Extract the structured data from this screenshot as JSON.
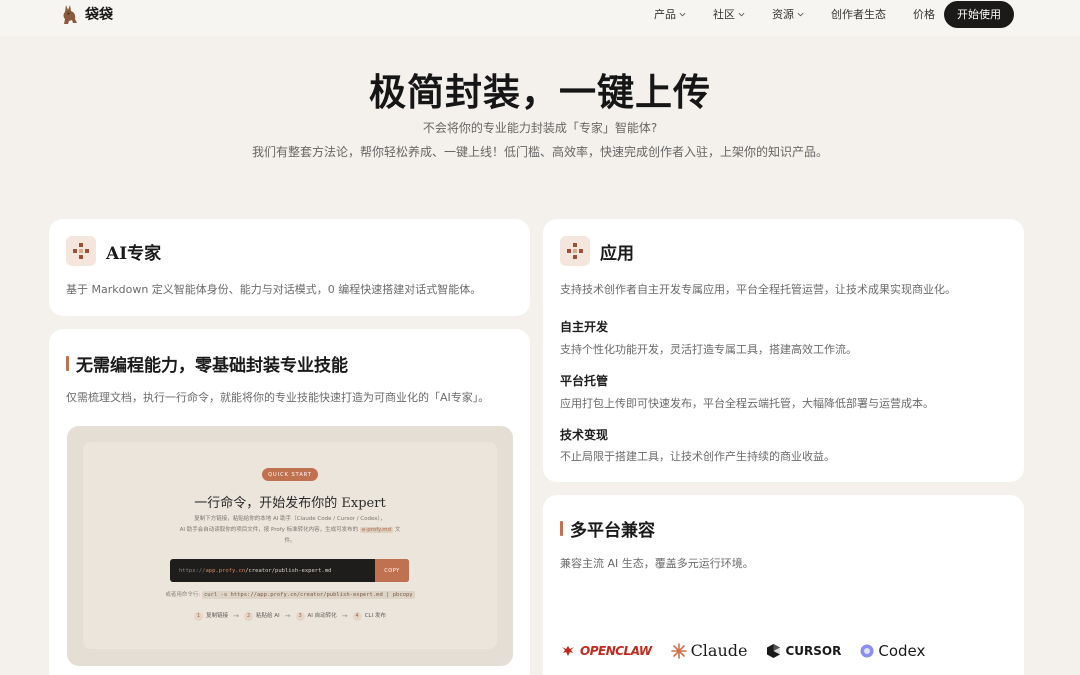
{
  "header": {
    "brand": "袋袋",
    "nav": [
      {
        "label": "产品",
        "dropdown": true
      },
      {
        "label": "社区",
        "dropdown": true
      },
      {
        "label": "资源",
        "dropdown": true
      },
      {
        "label": "创作者生态",
        "dropdown": false
      },
      {
        "label": "价格",
        "dropdown": false
      }
    ],
    "cta": "开始使用"
  },
  "hero": {
    "title": "极简封装，一键上传",
    "subtitle": "不会将你的专业能力封装成「专家」智能体?",
    "description": "我们有整套方法论，帮你轻松养成、一键上线！低门槛、高效率，快速完成创作者入驻，上架你的知识产品。"
  },
  "cards": {
    "ai_expert": {
      "title": "AI专家",
      "text": "基于 Markdown 定义智能体身份、能力与对话模式，0 编程快速搭建对话式智能体。"
    },
    "no_code": {
      "title": "无需编程能力，零基础封装专业技能",
      "text": "仅需梳理文档，执行一行命令，就能将你的专业技能快速打造为可商业化的「AI专家」。",
      "mock": {
        "badge": "QUICK START",
        "title": "一行命令，开始发布你的 Expert",
        "desc_line1": "复制下方链接，粘贴给你的本地 AI 助手（Claude Code / Cursor / Codex），",
        "desc_line2a": "AI 助手会自动读取你的项目文件，按 Profy 标准转化内容，生成可发布的",
        "desc_code": "e-profy.md",
        "desc_line2b": "文件。",
        "cmd_prefix": "https://",
        "cmd_host": "app.profy.cn",
        "cmd_path": "/creator/publish-expert.md",
        "copy": "COPY",
        "alt_label": "或者用命令行:",
        "alt_cmd": "curl -s https://app.profy.cn/creator/publish-expert.md | pbcopy",
        "steps": [
          {
            "num": "1",
            "label": "复制链接"
          },
          {
            "num": "2",
            "label": "粘贴给 AI"
          },
          {
            "num": "3",
            "label": "AI 自动转化"
          },
          {
            "num": "4",
            "label": "CLI 发布"
          }
        ]
      }
    },
    "apps": {
      "title": "应用",
      "text": "支持技术创作者自主开发专属应用，平台全程托管运营，让技术成果实现商业化。",
      "features": [
        {
          "title": "自主开发",
          "text": "支持个性化功能开发，灵活打造专属工具，搭建高效工作流。"
        },
        {
          "title": "平台托管",
          "text": "应用打包上传即可快速发布，平台全程云端托管，大幅降低部署与运营成本。"
        },
        {
          "title": "技术变现",
          "text": "不止局限于搭建工具，让技术创作产生持续的商业收益。"
        }
      ]
    },
    "multi_platform": {
      "title": "多平台兼容",
      "text": "兼容主流 AI 生态，覆盖多元运行环境。",
      "logos": [
        "OPENCLAW",
        "Claude",
        "CURSOR",
        "Codex"
      ]
    }
  },
  "colors": {
    "background": "#f4f1ec",
    "accent": "#c0714f",
    "cta": "#1c1a18"
  }
}
